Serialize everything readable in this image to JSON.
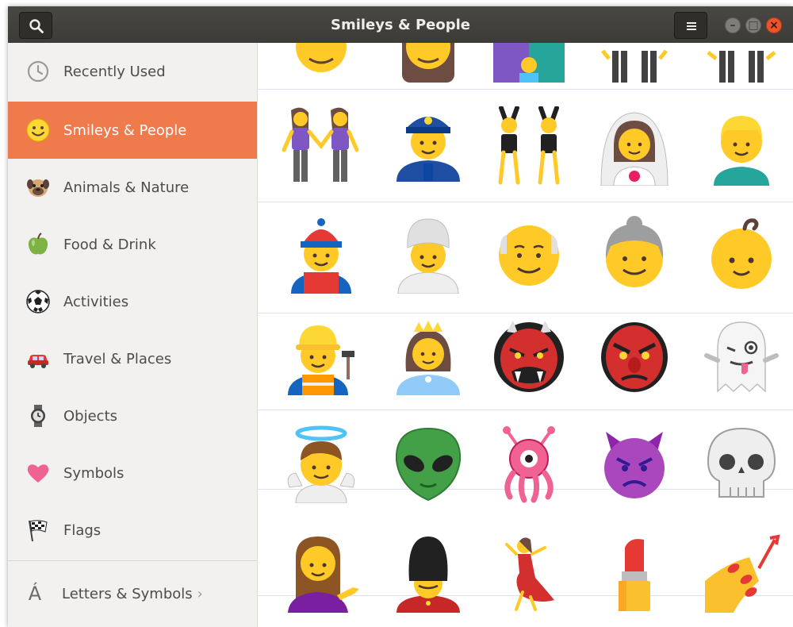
{
  "window": {
    "title": "Smileys & People"
  },
  "sidebar": {
    "items": [
      {
        "label": "Recently Used",
        "icon": "clock-icon"
      },
      {
        "label": "Smileys & People",
        "icon": "smiley-icon",
        "active": true
      },
      {
        "label": "Animals & Nature",
        "icon": "dog-icon"
      },
      {
        "label": "Food & Drink",
        "icon": "apple-icon"
      },
      {
        "label": "Activities",
        "icon": "soccer-ball-icon"
      },
      {
        "label": "Travel & Places",
        "icon": "car-icon"
      },
      {
        "label": "Objects",
        "icon": "watch-icon"
      },
      {
        "label": "Symbols",
        "icon": "heart-icon"
      },
      {
        "label": "Flags",
        "icon": "checkered-flag-icon"
      }
    ],
    "footer": {
      "label": "Letters & Symbols",
      "icon": "letter-a-acute-icon",
      "glyph": "Á",
      "chevron": "›"
    }
  },
  "colors": {
    "accent": "#ef7a4b",
    "titlebar": "#3c3b37",
    "close": "#e9542b"
  },
  "emoji_grid": {
    "rows": [
      [
        "person-emoji",
        "woman-emoji",
        "family-emoji",
        "men-holding-hands-emoji",
        "people-holding-hands-emoji"
      ],
      [
        "two-women-holding-hands-emoji",
        "police-officer-emoji",
        "women-with-bunny-ears-emoji",
        "bride-with-veil-emoji",
        "blond-person-emoji"
      ],
      [
        "man-with-chinese-cap-emoji",
        "man-with-turban-emoji",
        "older-man-emoji",
        "older-woman-emoji",
        "baby-emoji"
      ],
      [
        "construction-worker-emoji",
        "princess-emoji",
        "ogre-emoji",
        "goblin-emoji",
        "ghost-emoji"
      ],
      [
        "baby-angel-emoji",
        "alien-emoji",
        "alien-monster-emoji",
        "angry-devil-emoji",
        "skull-emoji"
      ],
      [
        "person-tipping-hand-emoji",
        "guard-emoji",
        "woman-dancing-emoji",
        "lipstick-emoji",
        "nail-polish-emoji"
      ]
    ]
  }
}
